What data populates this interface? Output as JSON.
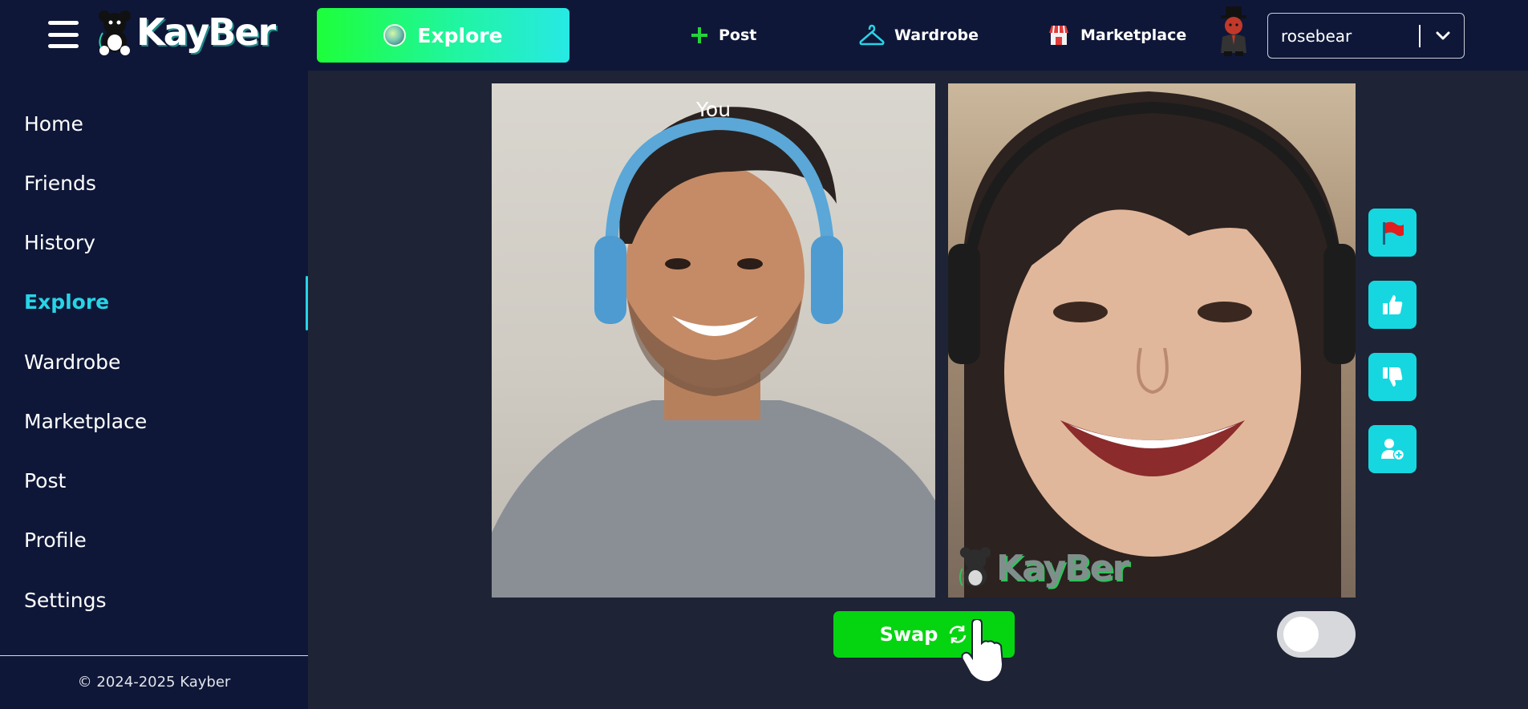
{
  "header": {
    "brand": "KayBer",
    "explore_label": "Explore",
    "nav": {
      "post": "Post",
      "wardrobe": "Wardrobe",
      "marketplace": "Marketplace"
    },
    "user": {
      "selected": "rosebear"
    }
  },
  "sidebar": {
    "items": [
      {
        "label": "Home"
      },
      {
        "label": "Friends"
      },
      {
        "label": "History"
      },
      {
        "label": "Explore",
        "active": true
      },
      {
        "label": "Wardrobe"
      },
      {
        "label": "Marketplace"
      },
      {
        "label": "Post"
      },
      {
        "label": "Profile"
      },
      {
        "label": "Settings"
      }
    ],
    "copyright": "© 2024-2025 Kayber"
  },
  "video": {
    "self_label": "You",
    "watermark": "KayBer"
  },
  "actions": {
    "icons": [
      "flag-icon",
      "thumbs-up-icon",
      "thumbs-down-icon",
      "add-friend-icon"
    ]
  },
  "controls": {
    "swap_label": "Swap",
    "toggle_on": false
  },
  "colors": {
    "accent": "#27d4e6",
    "swap_green": "#05d511",
    "bar_bg": "#0f1738",
    "content_bg": "#1e2335",
    "action_cyan": "#16d7e0"
  }
}
